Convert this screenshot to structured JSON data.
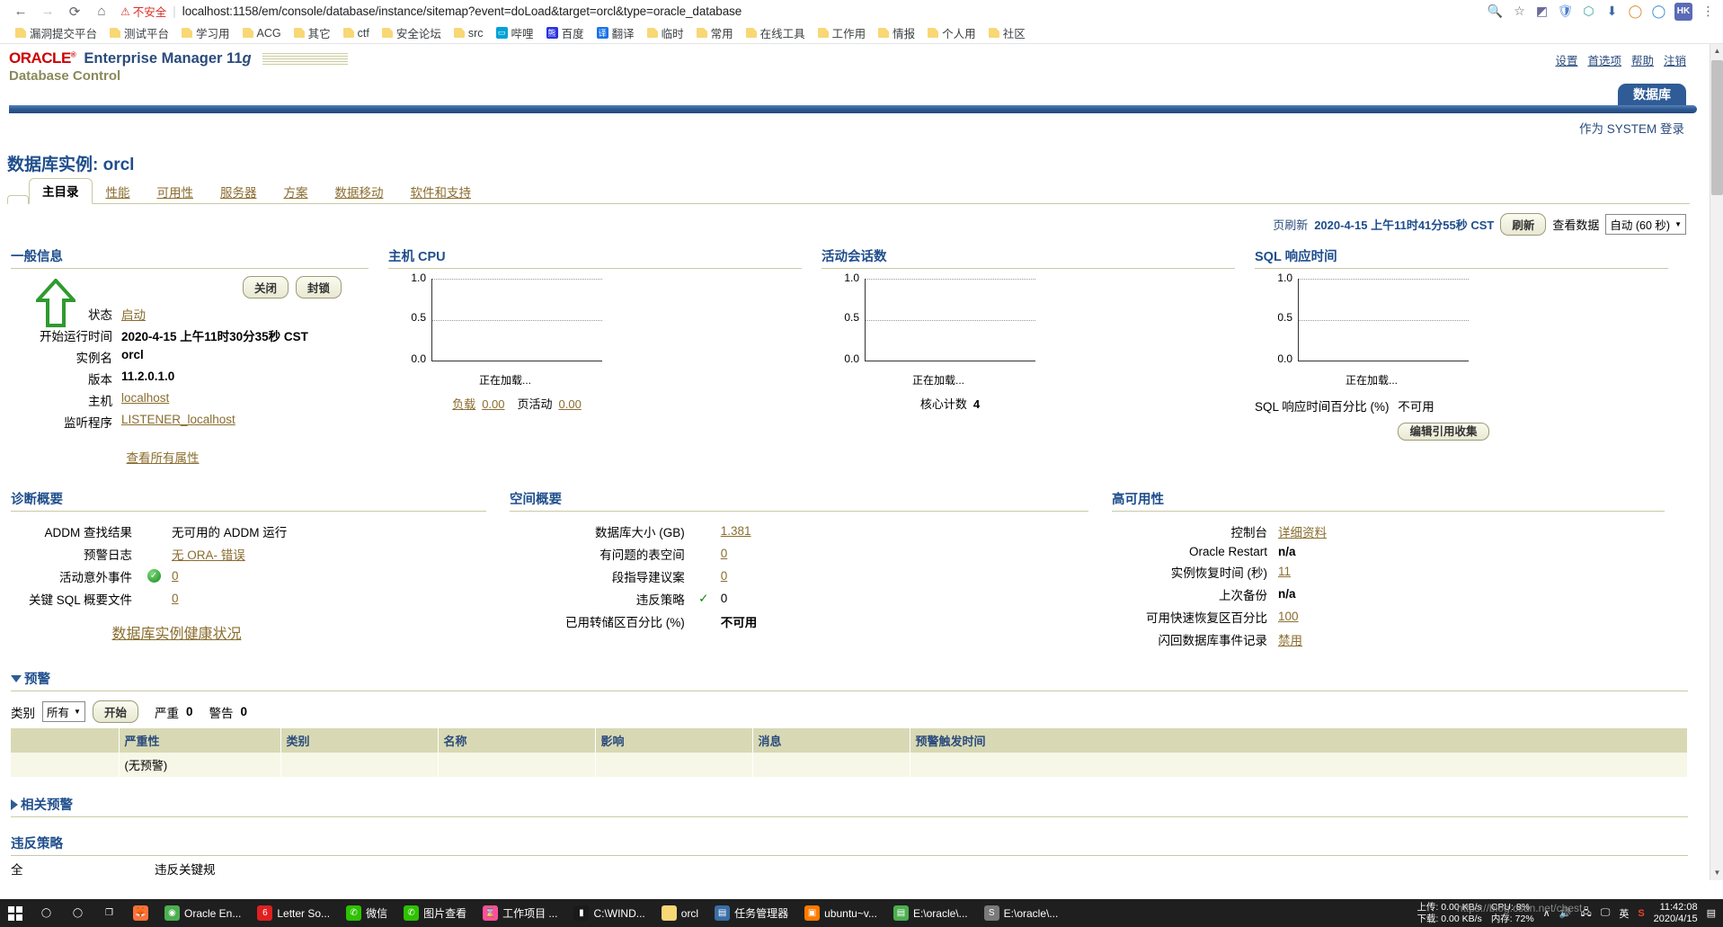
{
  "browser": {
    "nav": {
      "back": "←",
      "forward": "→",
      "reload": "⟳",
      "home": "⌂"
    },
    "security_label": "不安全",
    "url": "localhost:1158/em/console/database/instance/sitemap?event=doLoad&target=orcl&type=oracle_database",
    "omni_icons": [
      "zoom-icon",
      "star-icon"
    ],
    "ext_icons": [
      "extension-icon",
      "shield-icon",
      "puzzle-icon",
      "download-icon",
      "user-icon",
      "more-icon"
    ],
    "profile_initials": "HK",
    "bookmarks": [
      {
        "label": "漏洞提交平台",
        "icon": "folder"
      },
      {
        "label": "测试平台",
        "icon": "folder"
      },
      {
        "label": "学习用",
        "icon": "folder"
      },
      {
        "label": "ACG",
        "icon": "folder"
      },
      {
        "label": "其它",
        "icon": "folder"
      },
      {
        "label": "ctf",
        "icon": "folder"
      },
      {
        "label": "安全论坛",
        "icon": "folder"
      },
      {
        "label": "src",
        "icon": "folder"
      },
      {
        "label": "哔哩",
        "icon": "bilibili",
        "color": "#00a1d6",
        "glyph": "▭"
      },
      {
        "label": "百度",
        "icon": "baidu",
        "color": "#2932e1",
        "glyph": "熊"
      },
      {
        "label": "翻译",
        "icon": "translate",
        "color": "#1a73e8",
        "glyph": "译"
      },
      {
        "label": "临时",
        "icon": "folder"
      },
      {
        "label": "常用",
        "icon": "folder"
      },
      {
        "label": "在线工具",
        "icon": "folder"
      },
      {
        "label": "工作用",
        "icon": "folder"
      },
      {
        "label": "情报",
        "icon": "folder"
      },
      {
        "label": "个人用",
        "icon": "folder"
      },
      {
        "label": "社区",
        "icon": "folder"
      }
    ]
  },
  "em": {
    "brand": "ORACLE",
    "product": "Enterprise Manager 11",
    "product_version_g": "g",
    "subtitle": "Database Control",
    "top_links": [
      "设置",
      "首选项",
      "帮助",
      "注销"
    ],
    "db_tab": "数据库",
    "login_as": "作为 SYSTEM 登录",
    "instance_title": "数据库实例: orcl",
    "tabs": [
      {
        "label": "主目录",
        "active": true
      },
      {
        "label": "性能",
        "active": false
      },
      {
        "label": "可用性",
        "active": false
      },
      {
        "label": "服务器",
        "active": false
      },
      {
        "label": "方案",
        "active": false
      },
      {
        "label": "数据移动",
        "active": false
      },
      {
        "label": "软件和支持",
        "active": false
      }
    ],
    "refresh": {
      "label": "页刷新",
      "timestamp": "2020-4-15 上午11时41分55秒 CST",
      "button": "刷新",
      "view_label": "查看数据",
      "view_value": "自动 (60 秒)"
    },
    "general": {
      "heading": "一般信息",
      "buttons": [
        "关闭",
        "封锁"
      ],
      "rows": [
        {
          "label": "状态",
          "value": "启动",
          "link": true,
          "bold": false
        },
        {
          "label": "开始运行时间",
          "value": "2020-4-15 上午11时30分35秒 CST",
          "link": false,
          "bold": true
        },
        {
          "label": "实例名",
          "value": "orcl",
          "link": false,
          "bold": true
        },
        {
          "label": "版本",
          "value": "11.2.0.1.0",
          "link": false,
          "bold": true
        },
        {
          "label": "主机",
          "value": "localhost",
          "link": true,
          "bold": false
        },
        {
          "label": "监听程序",
          "value": "LISTENER_localhost",
          "link": true,
          "bold": false
        }
      ],
      "view_all": "查看所有属性"
    },
    "host_cpu": {
      "heading": "主机 CPU",
      "loading": "正在加载...",
      "foot": [
        {
          "label": "负载",
          "value": "0.00"
        },
        {
          "label": "页活动",
          "value": "0.00"
        }
      ]
    },
    "active_sessions": {
      "heading": "活动会话数",
      "loading": "正在加载...",
      "foot": [
        {
          "label": "核心计数",
          "value": "4"
        }
      ]
    },
    "sql_response": {
      "heading": "SQL 响应时间",
      "loading": "正在加载...",
      "pct_label": "SQL 响应时间百分比 (%)",
      "pct_value": "不可用",
      "button": "编辑引用收集"
    },
    "diagnostics": {
      "heading": "诊断概要",
      "rows": [
        {
          "label": "ADDM 查找结果",
          "value": "无可用的 ADDM 运行",
          "link": false,
          "badge": null,
          "label_link": "查找"
        },
        {
          "label": "预警日志",
          "value": "无 ORA- 错误",
          "link": true,
          "badge": null
        },
        {
          "label": "活动意外事件",
          "value": "0",
          "link": true,
          "badge": "green-check"
        },
        {
          "label": "关键 SQL 概要文件",
          "value": "0",
          "link": true,
          "badge": null
        }
      ],
      "footer_link": "数据库实例健康状况"
    },
    "space": {
      "heading": "空间概要",
      "rows": [
        {
          "label": "数据库大小 (GB)",
          "value": "1.381",
          "link": true,
          "check": false,
          "bold": false
        },
        {
          "label": "有问题的表空间",
          "value": "0",
          "link": true,
          "check": false,
          "bold": false
        },
        {
          "label": "段指导建议案",
          "value": "0",
          "link": true,
          "check": false,
          "bold": false
        },
        {
          "label": "违反策略",
          "value": "0",
          "link": false,
          "check": true,
          "bold": false
        },
        {
          "label": "已用转储区百分比 (%)",
          "value": "不可用",
          "link": false,
          "check": false,
          "bold": true
        }
      ]
    },
    "ha": {
      "heading": "高可用性",
      "rows": [
        {
          "label": "控制台",
          "value": "详细资料",
          "link": true,
          "bold": false
        },
        {
          "label": "Oracle Restart",
          "value": "n/a",
          "link": false,
          "bold": true
        },
        {
          "label": "实例恢复时间 (秒)",
          "value": "11",
          "link": true,
          "bold": false
        },
        {
          "label": "上次备份",
          "value": "n/a",
          "link": false,
          "bold": true
        },
        {
          "label": "可用快速恢复区百分比",
          "value": "100",
          "link": true,
          "bold": false
        },
        {
          "label": "闪回数据库事件记录",
          "value": "禁用",
          "link": true,
          "bold": false
        }
      ]
    },
    "alerts": {
      "heading": "预警",
      "category_label": "类别",
      "category_value": "所有",
      "go_button": "开始",
      "critical_label": "严重",
      "critical_value": "0",
      "warning_label": "警告",
      "warning_value": "0",
      "columns": [
        "",
        "严重性",
        "类别",
        "名称",
        "影响",
        "消息",
        "预警触发时间"
      ],
      "empty_row": "(无预警)"
    },
    "related_alerts": {
      "heading": "相关预警"
    },
    "policy_violations": {
      "heading": "违反策略",
      "col1": "全",
      "col2": "违反关键规"
    }
  },
  "taskbar": {
    "start": "start-icon",
    "items": [
      {
        "label": "",
        "icon": "search",
        "color": "transparent",
        "glyph": "◯"
      },
      {
        "label": "",
        "icon": "cortana",
        "color": "transparent",
        "glyph": "◯"
      },
      {
        "label": "",
        "icon": "taskview",
        "color": "transparent",
        "glyph": "❐"
      },
      {
        "label": "",
        "icon": "firefox",
        "color": "#ff7139",
        "glyph": "🦊"
      },
      {
        "label": "Oracle En...",
        "icon": "chrome",
        "color": "#4caf50",
        "glyph": "◉"
      },
      {
        "label": "Letter So...",
        "icon": "letter",
        "color": "#e02020",
        "glyph": "6"
      },
      {
        "label": "微信",
        "icon": "wechat",
        "color": "#2dc100",
        "glyph": "✆"
      },
      {
        "label": "图片查看",
        "icon": "wechat2",
        "color": "#2dc100",
        "glyph": "✆"
      },
      {
        "label": "工作项目 ...",
        "icon": "project",
        "color": "#ff4f9a",
        "glyph": "⌛"
      },
      {
        "label": "C:\\WIND...",
        "icon": "cmd",
        "color": "#1a1a1a",
        "glyph": "▮"
      },
      {
        "label": "orcl",
        "icon": "folder",
        "color": "#f8d775",
        "glyph": ""
      },
      {
        "label": "任务管理器",
        "icon": "taskmgr",
        "color": "#3a6ea5",
        "glyph": "▤"
      },
      {
        "label": "ubuntu~v...",
        "icon": "vmware",
        "color": "#ff7a00",
        "glyph": "▣"
      },
      {
        "label": "E:\\oracle\\...",
        "icon": "editor",
        "color": "#4caf50",
        "glyph": "▤"
      },
      {
        "label": "E:\\oracle\\...",
        "icon": "sqldev",
        "color": "#7a7a7a",
        "glyph": "S"
      }
    ],
    "net": {
      "up": "上传: 0.00 KB/s",
      "down": "下载: 0.00 KB/s"
    },
    "perf": {
      "cpu": "CPU: 8%",
      "mem": "内存: 72%"
    },
    "tray": [
      "chevron-up-icon",
      "volume-icon",
      "network-icon",
      "monitor-icon"
    ],
    "ime": "英",
    "sogou": "S",
    "clock": {
      "time": "11:42:08",
      "date": "2020/4/15"
    },
    "watermark": "https://blog.csdn.net/chest_"
  },
  "chart_data": [
    {
      "type": "line",
      "title": "主机 CPU",
      "x": [],
      "values": [],
      "ylabel": "",
      "xlabel": "",
      "ylim": [
        0.0,
        1.0
      ],
      "yticks": [
        "0.0",
        "0.5",
        "1.0"
      ],
      "grid": true,
      "status": "正在加载..."
    },
    {
      "type": "line",
      "title": "活动会话数",
      "x": [],
      "values": [],
      "ylabel": "",
      "xlabel": "",
      "ylim": [
        0.0,
        1.0
      ],
      "yticks": [
        "0.0",
        "0.5",
        "1.0"
      ],
      "grid": true,
      "status": "正在加载..."
    },
    {
      "type": "line",
      "title": "SQL 响应时间",
      "x": [],
      "values": [],
      "ylabel": "",
      "xlabel": "",
      "ylim": [
        0.0,
        1.0
      ],
      "yticks": [
        "0.0",
        "0.5",
        "1.0"
      ],
      "grid": true,
      "status": "正在加载..."
    }
  ]
}
